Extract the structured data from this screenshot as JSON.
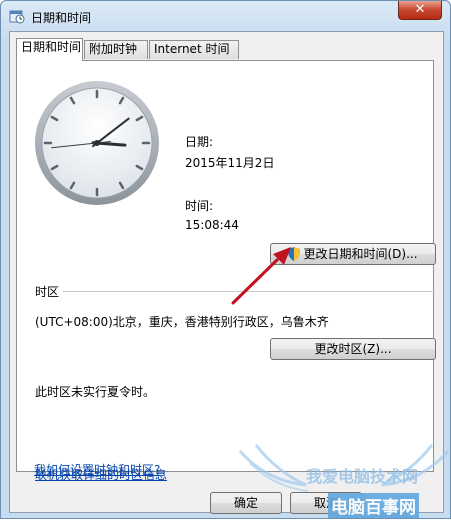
{
  "window": {
    "title": "日期和时间",
    "close_label": "✕"
  },
  "tabs": [
    {
      "label": "日期和时间"
    },
    {
      "label": "附加时钟"
    },
    {
      "label": "Internet 时间"
    }
  ],
  "date": {
    "label": "日期:",
    "value": "2015年11月2日"
  },
  "time": {
    "label": "时间:",
    "value": "15:08:44"
  },
  "clock_time": {
    "hour": 15,
    "minute": 8,
    "second": 44
  },
  "buttons": {
    "change_datetime": "更改日期和时间(D)...",
    "change_timezone": "更改时区(Z)...",
    "ok": "确定",
    "cancel": "取消"
  },
  "timezone": {
    "section_label": "时区",
    "value": "(UTC+08:00)北京，重庆，香港特别行政区，乌鲁木齐",
    "dst_note": "此时区未实行夏令时。"
  },
  "links": {
    "online_info": "联机获取详细的时区信息",
    "how_to": "我如何设置时钟和时区?"
  },
  "watermark": {
    "line1": "我爱电脑技术网",
    "line2": "电脑百事网"
  },
  "colors": {
    "link": "#0645ad",
    "arrow": "#c1121f"
  }
}
